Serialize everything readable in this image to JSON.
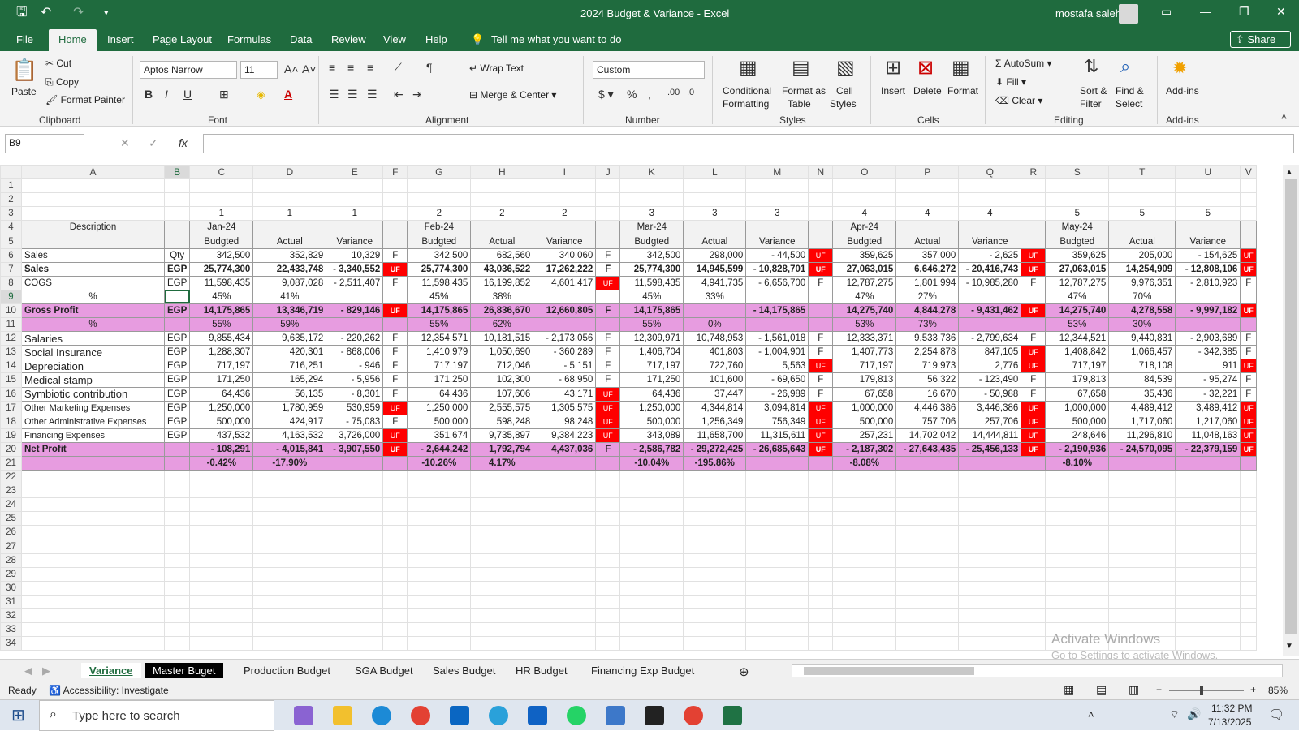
{
  "app": {
    "title": "2024 Budget & Variance  -  Excel",
    "user": "mostafa saleh"
  },
  "menu": {
    "tabs": [
      "File",
      "Home",
      "Insert",
      "Page Layout",
      "Formulas",
      "Data",
      "Review",
      "View",
      "Help"
    ],
    "tell": "Tell me what you want to do",
    "share": "Share"
  },
  "ribbon": {
    "clipboard": {
      "paste": "Paste",
      "cut": "Cut",
      "copy": "Copy",
      "painter": "Format Painter",
      "group": "Clipboard"
    },
    "font": {
      "name": "Aptos Narrow",
      "size": "11",
      "group": "Font"
    },
    "alignment": {
      "wrap": "Wrap Text",
      "merge": "Merge & Center",
      "group": "Alignment"
    },
    "number": {
      "format": "Custom",
      "group": "Number"
    },
    "styles": {
      "cond": "Conditional",
      "cond2": "Formatting",
      "fmt": "Format as",
      "fmt2": "Table",
      "cell": "Cell",
      "cell2": "Styles",
      "group": "Styles"
    },
    "cells": {
      "insert": "Insert",
      "delete": "Delete",
      "format": "Format",
      "group": "Cells"
    },
    "editing": {
      "autosum": "AutoSum",
      "fill": "Fill",
      "clear": "Clear",
      "sort": "Sort &",
      "sort2": "Filter",
      "find": "Find &",
      "find2": "Select",
      "group": "Editing"
    },
    "addins": {
      "label": "Add-ins",
      "group": "Add-ins"
    }
  },
  "formula": {
    "namebox": "B9",
    "fx": "fx"
  },
  "columns": [
    "A",
    "B",
    "C",
    "D",
    "E",
    "F",
    "G",
    "H",
    "I",
    "J",
    "K",
    "L",
    "M",
    "N",
    "O",
    "P",
    "Q",
    "R",
    "S",
    "T",
    "U",
    "V"
  ],
  "rows": [
    {
      "n": "1",
      "cells": []
    },
    {
      "n": "2",
      "cells": []
    },
    {
      "n": "3",
      "cells": [
        "",
        "",
        "1",
        "1",
        "1",
        "",
        "2",
        "2",
        "2",
        "",
        "3",
        "3",
        "3",
        "",
        "4",
        "4",
        "4",
        "",
        "5",
        "5",
        "5",
        ""
      ]
    },
    {
      "n": "4",
      "cells": [
        "Description",
        "",
        "Jan-24",
        "",
        "",
        "",
        "Feb-24",
        "",
        "",
        "",
        "Mar-24",
        "",
        "",
        "",
        "Apr-24",
        "",
        "",
        "",
        "May-24",
        "",
        "",
        ""
      ]
    },
    {
      "n": "5",
      "cells": [
        "",
        "",
        "Budgted",
        "Actual",
        "Variance",
        "",
        "Budgted",
        "Actual",
        "Variance",
        "",
        "Budgted",
        "Actual",
        "Variance",
        "",
        "Budgted",
        "Actual",
        "Variance",
        "",
        "Budgted",
        "Actual",
        "Variance",
        ""
      ]
    },
    {
      "n": "6",
      "cells": [
        "Sales",
        "Qty",
        "342,500",
        "352,829",
        "10,329",
        "F",
        "342,500",
        "682,560",
        "340,060",
        "F",
        "342,500",
        "298,000",
        "-      44,500",
        "UF",
        "359,625",
        "357,000",
        "-      2,625",
        "UF",
        "359,625",
        "205,000",
        "-    154,625",
        "UF"
      ]
    },
    {
      "n": "7",
      "cells": [
        "Sales",
        "EGP",
        "25,774,300",
        "22,433,748",
        "-  3,340,552",
        "UF",
        "25,774,300",
        "43,036,522",
        "17,262,222",
        "F",
        "25,774,300",
        "14,945,599",
        "-  10,828,701",
        "UF",
        "27,063,015",
        "6,646,272",
        "-  20,416,743",
        "UF",
        "27,063,015",
        "14,254,909",
        "-  12,808,106",
        "UF"
      ]
    },
    {
      "n": "8",
      "cells": [
        "COGS",
        "EGP",
        "11,598,435",
        "9,087,028",
        "-  2,511,407",
        "F",
        "11,598,435",
        "16,199,852",
        "4,601,417",
        "UF",
        "11,598,435",
        "4,941,735",
        "-  6,656,700",
        "F",
        "12,787,275",
        "1,801,994",
        "-  10,985,280",
        "F",
        "12,787,275",
        "9,976,351",
        "-  2,810,923",
        "F"
      ]
    },
    {
      "n": "9",
      "cells": [
        "%",
        "",
        "45%",
        "41%",
        "",
        "",
        "45%",
        "38%",
        "",
        "",
        "45%",
        "33%",
        "",
        "",
        "47%",
        "27%",
        "",
        "",
        "47%",
        "70%",
        "",
        ""
      ]
    },
    {
      "n": "10",
      "cells": [
        "Gross Profit",
        "EGP",
        "14,175,865",
        "13,346,719",
        "-    829,146",
        "UF",
        "14,175,865",
        "26,836,670",
        "12,660,805",
        "F",
        "14,175,865",
        "",
        "-  14,175,865",
        "",
        "14,275,740",
        "4,844,278",
        "-  9,431,462",
        "UF",
        "14,275,740",
        "4,278,558",
        "-  9,997,182",
        "UF"
      ]
    },
    {
      "n": "11",
      "cells": [
        "%",
        "",
        "55%",
        "59%",
        "",
        "",
        "55%",
        "62%",
        "",
        "",
        "55%",
        "0%",
        "",
        "",
        "53%",
        "73%",
        "",
        "",
        "53%",
        "30%",
        "",
        ""
      ]
    },
    {
      "n": "12",
      "cells": [
        "Salaries",
        "EGP",
        "9,855,434",
        "9,635,172",
        "-    220,262",
        "F",
        "12,354,571",
        "10,181,515",
        "-  2,173,056",
        "F",
        "12,309,971",
        "10,748,953",
        "-  1,561,018",
        "F",
        "12,333,371",
        "9,533,736",
        "-  2,799,634",
        "F",
        "12,344,521",
        "9,440,831",
        "-  2,903,689",
        "F"
      ]
    },
    {
      "n": "13",
      "cells": [
        "Social Insurance",
        "EGP",
        "1,288,307",
        "420,301",
        "-    868,006",
        "F",
        "1,410,979",
        "1,050,690",
        "-    360,289",
        "F",
        "1,406,704",
        "401,803",
        "-  1,004,901",
        "F",
        "1,407,773",
        "2,254,878",
        "847,105",
        "UF",
        "1,408,842",
        "1,066,457",
        "-    342,385",
        "F"
      ]
    },
    {
      "n": "14",
      "cells": [
        "Depreciation",
        "EGP",
        "717,197",
        "716,251",
        "-        946",
        "F",
        "717,197",
        "712,046",
        "-      5,151",
        "F",
        "717,197",
        "722,760",
        "5,563",
        "UF",
        "717,197",
        "719,973",
        "2,776",
        "UF",
        "717,197",
        "718,108",
        "911",
        "UF"
      ]
    },
    {
      "n": "15",
      "cells": [
        "Medical stamp",
        "EGP",
        "171,250",
        "165,294",
        "-      5,956",
        "F",
        "171,250",
        "102,300",
        "-      68,950",
        "F",
        "171,250",
        "101,600",
        "-      69,650",
        "F",
        "179,813",
        "56,322",
        "-    123,490",
        "F",
        "179,813",
        "84,539",
        "-      95,274",
        "F"
      ]
    },
    {
      "n": "16",
      "cells": [
        "Symbiotic contribution",
        "EGP",
        "64,436",
        "56,135",
        "-      8,301",
        "F",
        "64,436",
        "107,606",
        "43,171",
        "UF",
        "64,436",
        "37,447",
        "-      26,989",
        "F",
        "67,658",
        "16,670",
        "-      50,988",
        "F",
        "67,658",
        "35,436",
        "-      32,221",
        "F"
      ]
    },
    {
      "n": "17",
      "cells": [
        "Other Marketing Expenses",
        "EGP",
        "1,250,000",
        "1,780,959",
        "530,959",
        "UF",
        "1,250,000",
        "2,555,575",
        "1,305,575",
        "UF",
        "1,250,000",
        "4,344,814",
        "3,094,814",
        "UF",
        "1,000,000",
        "4,446,386",
        "3,446,386",
        "UF",
        "1,000,000",
        "4,489,412",
        "3,489,412",
        "UF"
      ]
    },
    {
      "n": "18",
      "cells": [
        "Other Administrative Expenses",
        "EGP",
        "500,000",
        "424,917",
        "-      75,083",
        "F",
        "500,000",
        "598,248",
        "98,248",
        "UF",
        "500,000",
        "1,256,349",
        "756,349",
        "UF",
        "500,000",
        "757,706",
        "257,706",
        "UF",
        "500,000",
        "1,717,060",
        "1,217,060",
        "UF"
      ]
    },
    {
      "n": "19",
      "cells": [
        "Financing Expenses",
        "EGP",
        "437,532",
        "4,163,532",
        "3,726,000",
        "UF",
        "351,674",
        "9,735,897",
        "9,384,223",
        "UF",
        "343,089",
        "11,658,700",
        "11,315,611",
        "UF",
        "257,231",
        "14,702,042",
        "14,444,811",
        "UF",
        "248,646",
        "11,296,810",
        "11,048,163",
        "UF"
      ]
    },
    {
      "n": "20",
      "cells": [
        "Net Profit",
        "",
        "-      108,291",
        "-    4,015,841",
        "-  3,907,550",
        "UF",
        "-    2,644,242",
        "1,792,794",
        "4,437,036",
        "F",
        "-    2,586,782",
        "-  29,272,425",
        "-  26,685,643",
        "UF",
        "-    2,187,302",
        "-  27,643,435",
        "-  25,456,133",
        "UF",
        "-    2,190,936",
        "-  24,570,095",
        "-  22,379,159",
        "UF"
      ]
    },
    {
      "n": "21",
      "cells": [
        "",
        "",
        "-0.42%",
        "-17.90%",
        "",
        "",
        "-10.26%",
        "4.17%",
        "",
        "",
        "-10.04%",
        "-195.86%",
        "",
        "",
        "-8.08%",
        "",
        "",
        "",
        "-8.10%",
        "",
        "",
        ""
      ]
    }
  ],
  "empty_rows": [
    "22",
    "23",
    "24",
    "25",
    "26",
    "27",
    "28",
    "29",
    "30",
    "31",
    "32",
    "33",
    "34"
  ],
  "sheets": [
    "Variance",
    "Master Buget",
    "Production Budget",
    "SGA Budget",
    "Sales Budget",
    "HR Budget",
    "Financing Exp Budget"
  ],
  "status": {
    "ready": "Ready",
    "accessibility": "Accessibility: Investigate",
    "zoom": "85%"
  },
  "watermark": {
    "line1": "Activate Windows",
    "line2": "Go to Settings to activate Windows."
  },
  "taskbar": {
    "search": "Type here to search",
    "time": "11:32 PM",
    "date": "7/13/2025"
  },
  "colors": {
    "excel_green": "#1f6b3e",
    "pink": "#e79ce0",
    "red_flag": "#ff0000"
  }
}
